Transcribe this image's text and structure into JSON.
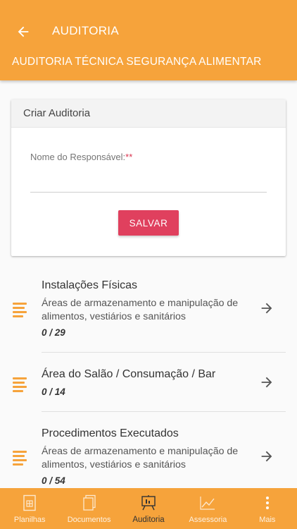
{
  "header": {
    "title": "AUDITORIA",
    "subtitle": "AUDITORIA TÉCNICA SEGURANÇA ALIMENTAR"
  },
  "form": {
    "title": "Criar Auditoria",
    "responsible_label": "Nome do Responsável:",
    "required_marker": "**",
    "responsible_value": "",
    "save_label": "SALVAR"
  },
  "sections": [
    {
      "title": "Instalações Físicas",
      "description": "Áreas de armazenamento e manipulação de alimentos, vestiários e sanitários",
      "count": "0 / 29"
    },
    {
      "title": "Área do Salão / Consumação / Bar",
      "description": "",
      "count": "0 / 14"
    },
    {
      "title": "Procedimentos Executados",
      "description": "Áreas de armazenamento e manipulação de alimentos, vestiários e sanitários",
      "count": "0 / 54"
    }
  ],
  "bottom_nav": [
    {
      "label": "Planilhas",
      "icon": "spreadsheet-icon",
      "active": false
    },
    {
      "label": "Documentos",
      "icon": "documents-icon",
      "active": false
    },
    {
      "label": "Auditoria",
      "icon": "audit-board-icon",
      "active": true
    },
    {
      "label": "Assessoria",
      "icon": "chart-line-icon",
      "active": false
    },
    {
      "label": "Mais",
      "icon": "more-vertical-icon",
      "active": false
    }
  ],
  "colors": {
    "brand_orange": "#f6a33b",
    "save_button": "#e0405e",
    "required_marker": "#d9344f"
  }
}
